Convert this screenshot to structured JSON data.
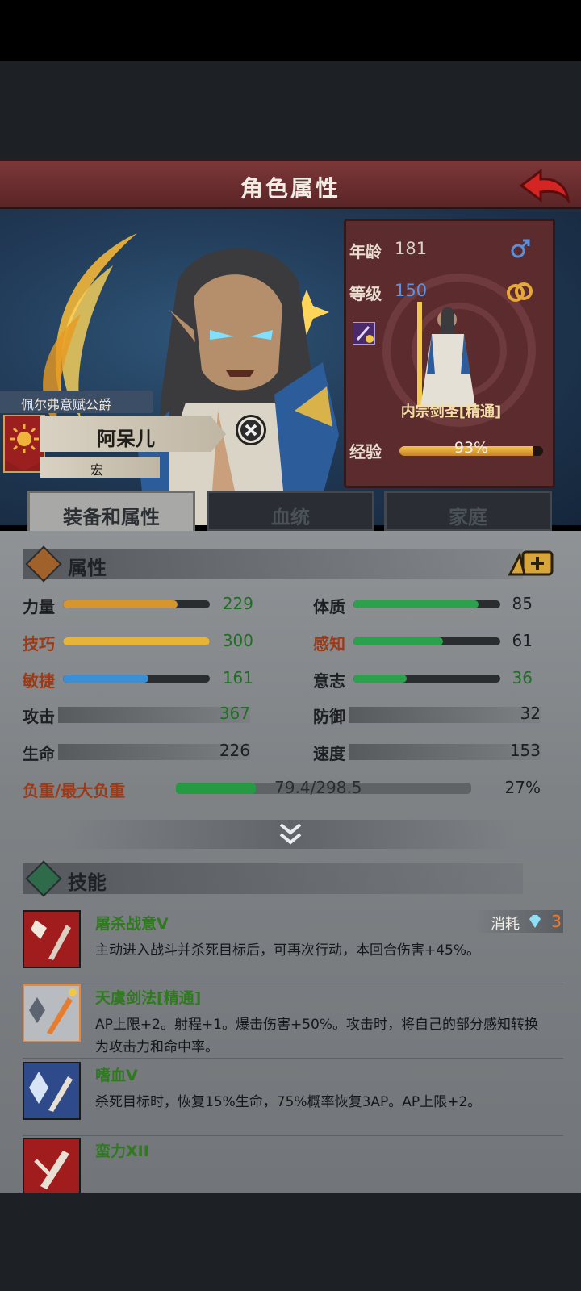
{
  "header": {
    "title": "角色属性",
    "back_icon": "red-back-arrow-icon"
  },
  "character": {
    "noble_title": "佩尔弗意赋公爵",
    "name": "阿呆儿",
    "sub_name": "宏",
    "age_label": "年龄",
    "age": "181",
    "level_label": "等级",
    "level": "150",
    "class_name": "内宗剑圣[精通]",
    "exp_label": "经验",
    "exp_text": "93%",
    "exp_fraction": 0.93,
    "gender_icon": "male-symbol-icon",
    "ring_icon": "ring-icon"
  },
  "tabs": [
    {
      "label": "装备和属性",
      "active": true
    },
    {
      "label": "血统",
      "active": false
    },
    {
      "label": "家庭",
      "active": false
    }
  ],
  "attributes": {
    "section_title": "属性",
    "stats": [
      {
        "name": "力量",
        "value": "229",
        "fraction": 0.78,
        "color": "#d7952e"
      },
      {
        "name": "技巧",
        "value": "300",
        "fraction": 1.0,
        "color": "#e7b43a"
      },
      {
        "name": "敏捷",
        "value": "161",
        "fraction": 0.58,
        "color": "#3b8fd6"
      },
      {
        "name": "体质",
        "value": "85",
        "fraction": 0.85,
        "color": "#2aa14a"
      },
      {
        "name": "感知",
        "value": "61",
        "fraction": 0.61,
        "color": "#2aa14a"
      },
      {
        "name": "意志",
        "value": "36",
        "fraction": 0.36,
        "color": "#2aa14a"
      }
    ],
    "combat": [
      {
        "name": "攻击",
        "value": "367"
      },
      {
        "name": "生命",
        "value": "226"
      },
      {
        "name": "防御",
        "value": "32"
      },
      {
        "name": "速度",
        "value": "153"
      }
    ],
    "load": {
      "label": "负重/最大负重",
      "text": "79.4/298.5",
      "percent": "27%",
      "fraction": 0.27
    }
  },
  "skills": {
    "section_title": "技能",
    "cost_label": "消耗",
    "cost_value": "3",
    "items": [
      {
        "name": "屠杀战意V",
        "desc": "主动进入战斗并杀死目标后，可再次行动，本回合伤害+45%。",
        "icon_bg": "#a11c1c"
      },
      {
        "name": "天虞剑法[精通]",
        "desc": "AP上限+2。射程+1。爆击伤害+50%。攻击时，将自己的部分感知转换为攻击力和命中率。",
        "icon_bg": "#b8bcc0"
      },
      {
        "name": "嗜血V",
        "desc": "杀死目标时，恢复15%生命，75%概率恢复3AP。AP上限+2。",
        "icon_bg": "#2e4a8a"
      },
      {
        "name": "蛮力XII",
        "desc": "",
        "icon_bg": "#a11c1c"
      }
    ]
  }
}
